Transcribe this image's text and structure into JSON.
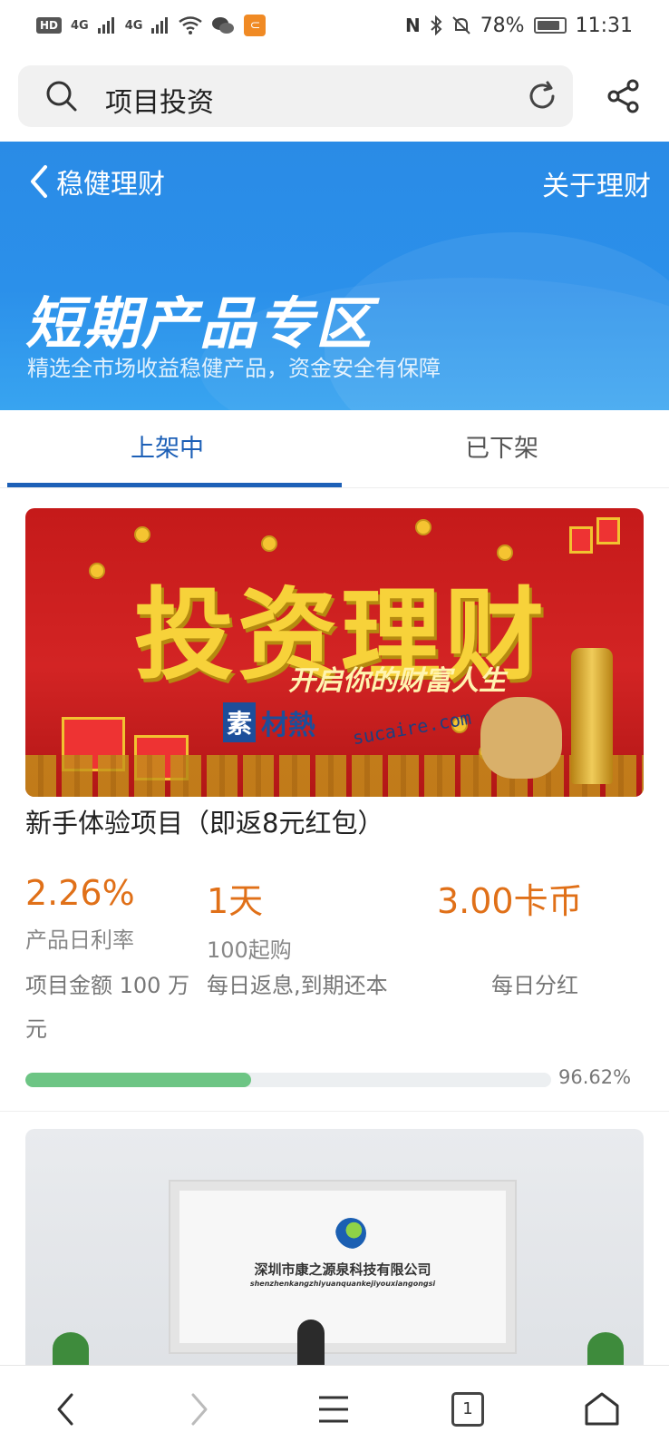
{
  "status_bar": {
    "hd_label": "HD",
    "signal1": "4G",
    "signal2": "4G",
    "battery_text": "78%",
    "time": "11:31"
  },
  "search": {
    "query": "项目投资"
  },
  "header": {
    "back_label": "稳健理财",
    "about_label": "关于理财",
    "title": "短期产品专区",
    "subtitle": "精选全市场收益稳健产品，资金安全有保障"
  },
  "tabs": [
    {
      "label": "上架中",
      "active": true
    },
    {
      "label": "已下架",
      "active": false
    }
  ],
  "product1": {
    "banner_main": "投资理财",
    "banner_tagline": "开启你的财富人生",
    "watermark_box": "素",
    "watermark_text": "材熱",
    "watermark_url": "sucaire.com",
    "title": "新手体验项目（即返8元红包）",
    "rate_value": "2.26%",
    "rate_label": "产品日利率",
    "term_value": "1天",
    "term_label": "100起购",
    "reward_value": "3.00卡币",
    "amount_info": "项目金额 100 万元",
    "repay_info": "每日返息,到期还本",
    "dividend_info": "每日分红",
    "progress_percent": 96.62,
    "progress_text": "96.62%"
  },
  "product2": {
    "company_name": "深圳市康之源泉科技有限公司",
    "company_pinyin": "shenzhenkangzhiyuanquankejiyouxiangongsi"
  },
  "bottom_nav": {
    "tab_count": "1"
  },
  "colors": {
    "accent_blue": "#1d60b7",
    "header_blue": "#2b90ea",
    "value_orange": "#e07018",
    "progress_green": "#6dc584"
  }
}
